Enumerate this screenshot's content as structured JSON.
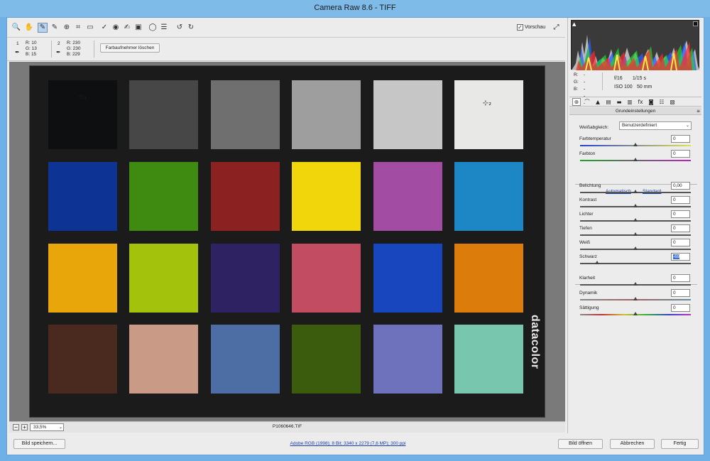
{
  "title": "Camera Raw 8.6 - TIFF",
  "toolbar": {
    "tools": [
      {
        "name": "zoom-tool-icon",
        "glyph": "🔍"
      },
      {
        "name": "hand-tool-icon",
        "glyph": "✋"
      },
      {
        "name": "white-balance-tool-icon",
        "glyph": "✎",
        "active": true
      },
      {
        "name": "color-sampler-tool-icon",
        "glyph": "✎"
      },
      {
        "name": "targeted-adjustment-tool-icon",
        "glyph": "⊕"
      },
      {
        "name": "crop-tool-icon",
        "glyph": "⌗"
      },
      {
        "name": "straighten-tool-icon",
        "glyph": "▭"
      },
      {
        "name": "spot-removal-tool-icon",
        "glyph": "✓"
      },
      {
        "name": "red-eye-tool-icon",
        "glyph": "◉"
      },
      {
        "name": "adjustment-brush-icon",
        "glyph": "✍"
      },
      {
        "name": "graduated-filter-icon",
        "glyph": "▣"
      },
      {
        "name": "radial-filter-icon",
        "glyph": "◯"
      },
      {
        "name": "preferences-icon",
        "glyph": "☰"
      },
      {
        "name": "rotate-left-icon",
        "glyph": "↺"
      },
      {
        "name": "rotate-right-icon",
        "glyph": "↻"
      }
    ],
    "preview_label": "Vorschau",
    "preview_checked": "✓"
  },
  "samplers": [
    {
      "num": "1",
      "values": [
        "R:  10",
        "G:  13",
        "B:  15"
      ]
    },
    {
      "num": "2",
      "values": [
        "R: 230",
        "G: 230",
        "B: 229"
      ]
    }
  ],
  "clear_samplers": "Farbaufnehmer löschen",
  "patches": [
    "#0d0f10",
    "#474747",
    "#6f6f6f",
    "#9e9e9e",
    "#c6c6c6",
    "#e8e8e6",
    "#0d3394",
    "#3f8b12",
    "#8b2121",
    "#f2d60c",
    "#a34ca4",
    "#1c87c4",
    "#e9a60a",
    "#a3c20c",
    "#2e2262",
    "#c24c62",
    "#1846bf",
    "#dc7c0a",
    "#4a2a1e",
    "#c99a86",
    "#4c6ea4",
    "#3c5c0d",
    "#6e72bc",
    "#79c6ae"
  ],
  "sampler_marks": [
    {
      "label": "⊹₁"
    },
    {
      "label": "⊹₂"
    }
  ],
  "brand": "datacolor",
  "status": {
    "zoom": "33,5%",
    "filename": "P1060646.TIF"
  },
  "bottom": {
    "save": "Bild speichern...",
    "info_link": "Adobe RGB (1998); 8 Bit; 3340 x 2279 (7,6 MP); 300 ppi",
    "open": "Bild öffnen",
    "cancel": "Abbrechen",
    "done": "Fertig"
  },
  "histogram": {
    "clip_shadow": "▲"
  },
  "readout": {
    "labels": [
      "R:",
      "G:",
      "B:"
    ],
    "values": [
      "---",
      "---",
      "---"
    ],
    "aperture": "f/16",
    "shutter": "1/15 s",
    "iso": "ISO 100",
    "focal": "50 mm"
  },
  "panel_tabs": [
    {
      "name": "tab-basic",
      "glyph": "⊛",
      "active": true
    },
    {
      "name": "tab-tone-curve",
      "glyph": "⌒"
    },
    {
      "name": "tab-detail",
      "glyph": "▲"
    },
    {
      "name": "tab-hsl",
      "glyph": "▤"
    },
    {
      "name": "tab-split-toning",
      "glyph": "▬"
    },
    {
      "name": "tab-lens-corrections",
      "glyph": "▥"
    },
    {
      "name": "tab-effects",
      "glyph": "fx"
    },
    {
      "name": "tab-camera-calibration",
      "glyph": "◙"
    },
    {
      "name": "tab-presets",
      "glyph": "☷"
    },
    {
      "name": "tab-snapshots",
      "glyph": "▧"
    }
  ],
  "panel_title": "Grundeinstellungen",
  "white_balance": {
    "label": "Weißabgleich:",
    "value": "Benutzerdefiniert"
  },
  "auto_label": "Automatisch",
  "default_label": "Standard",
  "sliders": [
    {
      "name": "temperature",
      "label": "Farbtemperatur",
      "value": "0",
      "pos": 0.5,
      "track": "temp"
    },
    {
      "name": "tint",
      "label": "Farbton",
      "value": "0",
      "pos": 0.5,
      "track": "tint"
    },
    {
      "name": "exposure",
      "label": "Belichtung",
      "value": "0,00",
      "pos": 0.5,
      "track": "plain"
    },
    {
      "name": "contrast",
      "label": "Kontrast",
      "value": "0",
      "pos": 0.5,
      "track": "plain"
    },
    {
      "name": "highlights",
      "label": "Lichter",
      "value": "0",
      "pos": 0.5,
      "track": "plain"
    },
    {
      "name": "shadows",
      "label": "Tiefen",
      "value": "0",
      "pos": 0.5,
      "track": "plain"
    },
    {
      "name": "whites",
      "label": "Weiß",
      "value": "0",
      "pos": 0.5,
      "track": "plain"
    },
    {
      "name": "blacks",
      "label": "Schwarz",
      "value": "-69",
      "pos": 0.155,
      "track": "plain",
      "selected": true
    },
    {
      "name": "clarity",
      "label": "Klarheit",
      "value": "0",
      "pos": 0.5,
      "track": "plain"
    },
    {
      "name": "vibrance",
      "label": "Dynamik",
      "value": "0",
      "pos": 0.5,
      "track": "dyn"
    },
    {
      "name": "saturation",
      "label": "Sättigung",
      "value": "0",
      "pos": 0.5,
      "track": "sat"
    }
  ]
}
